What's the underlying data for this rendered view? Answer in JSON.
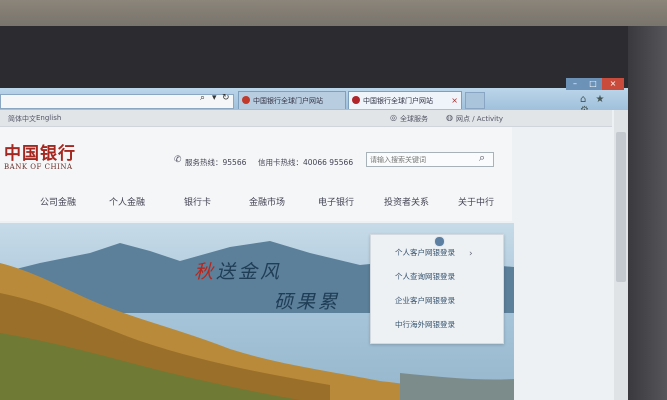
{
  "browser": {
    "tabs": [
      {
        "label": "中国银行全球门户网站"
      },
      {
        "label": "中国银行全球门户网站"
      }
    ],
    "active_tab_index": 1
  },
  "topbar": {
    "lang_cn": "简体中文",
    "lang_en": "English",
    "site_label": "全球服务",
    "account_label": "网点 / Activity"
  },
  "header": {
    "logo_cn": "中国银行",
    "logo_en": "BANK OF CHINA",
    "hotline": "服务热线：95566",
    "credit_hotline": "信用卡热线：40066 95566",
    "search_placeholder": "请输入搜索关键词"
  },
  "nav": {
    "items": [
      {
        "label": "公司金融"
      },
      {
        "label": "个人金融"
      },
      {
        "label": "银行卡"
      },
      {
        "label": "金融市场"
      },
      {
        "label": "电子银行"
      },
      {
        "label": "投资者关系"
      },
      {
        "label": "关于中行"
      }
    ]
  },
  "banner": {
    "line1_highlight": "秋",
    "line1_rest": "送金风",
    "line2": "硕果累"
  },
  "login_menu": {
    "items": [
      {
        "label": "个人客户网银登录"
      },
      {
        "label": "个人查询网银登录"
      },
      {
        "label": "企业客户网银登录"
      },
      {
        "label": "中行海外网银登录"
      }
    ]
  },
  "colors": {
    "brand_red": "#a5271f",
    "tab_bar": "#9fc0db"
  }
}
